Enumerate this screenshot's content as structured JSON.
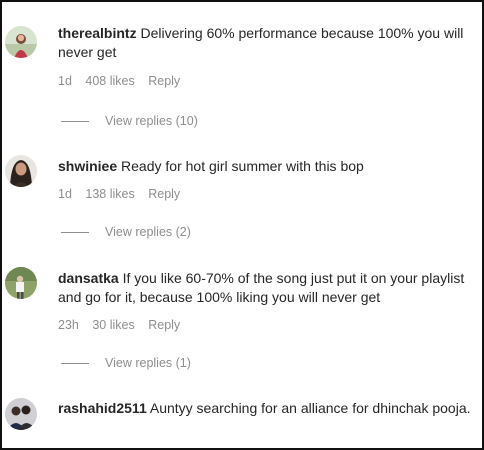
{
  "comments": [
    {
      "username": "therealbintz",
      "text": "Delivering 60% performance because 100% you will never get",
      "time": "1d",
      "likes": "408 likes",
      "reply_label": "Reply",
      "view_replies": "View replies (10)"
    },
    {
      "username": "shwiniee",
      "text": "Ready for hot girl summer with this bop",
      "time": "1d",
      "likes": "138 likes",
      "reply_label": "Reply",
      "view_replies": "View replies (2)"
    },
    {
      "username": "dansatka",
      "text": "If you like 60-70% of the song just put it on your playlist and go for it, because 100% liking you will never get",
      "time": "23h",
      "likes": "30 likes",
      "reply_label": "Reply",
      "view_replies": "View replies (1)"
    },
    {
      "username": "rashahid2511",
      "text": "Auntyy searching for an alliance for dhinchak pooja."
    }
  ]
}
